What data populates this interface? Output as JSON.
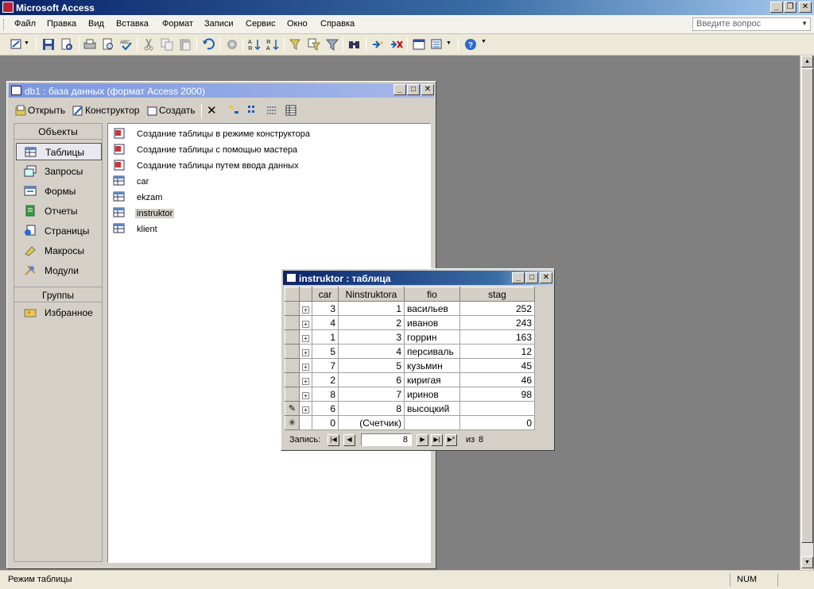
{
  "app": {
    "title": "Microsoft Access"
  },
  "menu": [
    "Файл",
    "Правка",
    "Вид",
    "Вставка",
    "Формат",
    "Записи",
    "Сервис",
    "Окно",
    "Справка"
  ],
  "help": {
    "placeholder": "Введите вопрос"
  },
  "db_window": {
    "title": "db1 : база данных (формат Access 2000)",
    "toolbar": {
      "open": "Открыть",
      "design": "Конструктор",
      "create": "Создать"
    },
    "objects_header": "Объекты",
    "groups_header": "Группы",
    "sidebar": [
      {
        "label": "Таблицы",
        "icon": "table-icon",
        "active": true
      },
      {
        "label": "Запросы",
        "icon": "query-icon"
      },
      {
        "label": "Формы",
        "icon": "form-icon"
      },
      {
        "label": "Отчеты",
        "icon": "report-icon"
      },
      {
        "label": "Страницы",
        "icon": "page-icon"
      },
      {
        "label": "Макросы",
        "icon": "macro-icon"
      },
      {
        "label": "Модули",
        "icon": "module-icon"
      }
    ],
    "favorites": "Избранное",
    "objects": [
      "Создание таблицы в режиме конструктора",
      "Создание таблицы с помощью мастера",
      "Создание таблицы путем ввода данных",
      "car",
      "ekzam",
      "instruktor",
      "klient"
    ]
  },
  "table_window": {
    "title": "instruktor : таблица",
    "columns": [
      "car",
      "Ninstruktora",
      "fio",
      "stag"
    ],
    "rows": [
      [
        "3",
        "1",
        "васильев",
        "252"
      ],
      [
        "4",
        "2",
        "иванов",
        "243"
      ],
      [
        "1",
        "3",
        "горрин",
        "163"
      ],
      [
        "5",
        "4",
        "персиваль",
        "12"
      ],
      [
        "7",
        "5",
        "кузьмин",
        "45"
      ],
      [
        "2",
        "6",
        "киригая",
        "46"
      ],
      [
        "8",
        "7",
        "иринов",
        "98"
      ],
      [
        "6",
        "8",
        "высоцкий",
        ""
      ]
    ],
    "new_row": [
      "0",
      "(Счетчик)",
      "",
      "0"
    ],
    "nav": {
      "label": "Запись:",
      "current": "8",
      "of_label": "из",
      "total": "8"
    }
  },
  "status": {
    "text": "Режим таблицы",
    "num": "NUM"
  }
}
